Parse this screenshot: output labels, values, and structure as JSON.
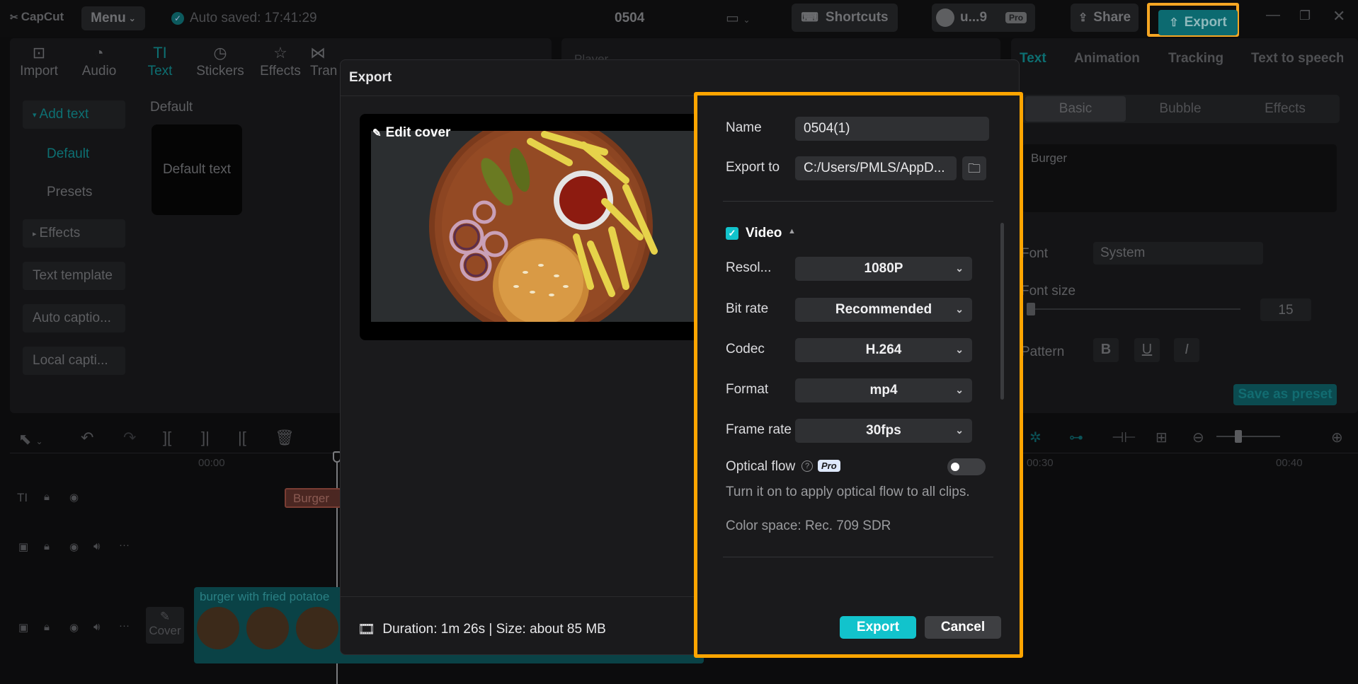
{
  "app": {
    "logo": "CapCut",
    "menu_label": "Menu",
    "autosave": "Auto saved: 17:41:29",
    "project_title": "0504",
    "shortcuts_label": "Shortcuts",
    "user_name": "u...9",
    "pro_badge": "Pro",
    "share_label": "Share",
    "export_label": "Export"
  },
  "tool_tabs": [
    {
      "label": "Import",
      "icon": "import-icon"
    },
    {
      "label": "Audio",
      "icon": "audio-icon"
    },
    {
      "label": "Text",
      "icon": "text-icon"
    },
    {
      "label": "Stickers",
      "icon": "stickers-icon"
    },
    {
      "label": "Effects",
      "icon": "effects-icon"
    },
    {
      "label": "Tran",
      "icon": "transitions-icon"
    }
  ],
  "left_panel": {
    "add_text": "Add text",
    "default": "Default",
    "presets": "Presets",
    "effects": "Effects",
    "text_template": "Text template",
    "auto_captions": "Auto captio...",
    "local_captions": "Local capti..."
  },
  "content": {
    "section_title": "Default",
    "card_label": "Default text",
    "player_label": "Player"
  },
  "right_panel": {
    "tabs": [
      "Text",
      "Animation",
      "Tracking",
      "Text to speech"
    ],
    "subtabs": [
      "Basic",
      "Bubble",
      "Effects"
    ],
    "text_value": "Burger",
    "font_label": "Font",
    "font_value": "System",
    "font_size_label": "Font size",
    "font_size_value": "15",
    "pattern_label": "Pattern",
    "save_preset": "Save as preset"
  },
  "export_dialog": {
    "title": "Export",
    "edit_cover": "Edit cover",
    "name_label": "Name",
    "name_value": "0504(1)",
    "export_to_label": "Export to",
    "export_to_value": "C:/Users/PMLS/AppD...",
    "video_label": "Video",
    "resolution_label": "Resol...",
    "resolution_value": "1080P",
    "bitrate_label": "Bit rate",
    "bitrate_value": "Recommended",
    "codec_label": "Codec",
    "codec_value": "H.264",
    "format_label": "Format",
    "format_value": "mp4",
    "framerate_label": "Frame rate",
    "framerate_value": "30fps",
    "optical_flow_label": "Optical flow",
    "optical_flow_hint": "Turn it on to apply optical flow to all clips.",
    "color_space": "Color space: Rec. 709 SDR",
    "duration_size": "Duration: 1m 26s | Size: about 85 MB",
    "export_btn": "Export",
    "cancel_btn": "Cancel"
  },
  "timeline": {
    "time_start": "00:00",
    "time_30": "00:30",
    "time_40": "00:40",
    "text_clip": "Burger",
    "video_clip": "burger with fried potatoe",
    "cover_label": "Cover"
  },
  "colors": {
    "accent": "#12c3cc",
    "highlight": "#ffa500"
  }
}
